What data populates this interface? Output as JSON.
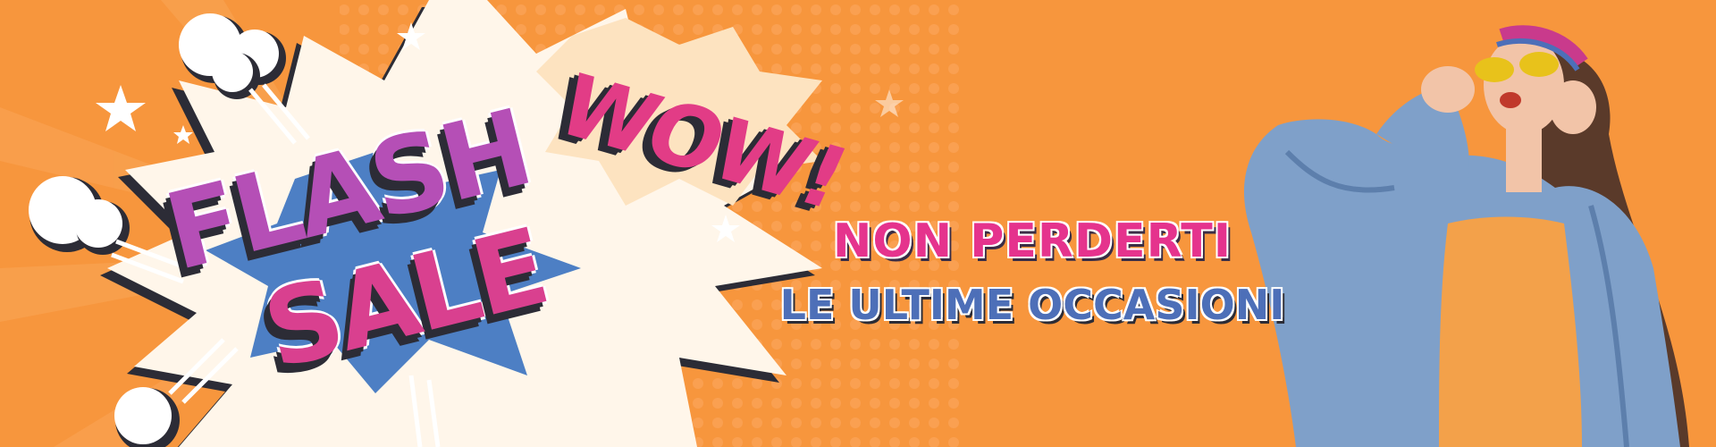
{
  "banner": {
    "flash_word": "FLASH",
    "sale_word": "SALE",
    "wow_word": "WOW!",
    "headline_line1": "NON PERDERTI",
    "headline_line2": "LE ULTIME OCCASIONI"
  },
  "colors": {
    "background": "#f7963d",
    "pink": "#e5338d",
    "purple": "#b54fb6",
    "blue": "#4d6fb8",
    "outline": "#2c2c36",
    "white": "#ffffff"
  },
  "icons": [
    "comic-burst-icon",
    "star-icon",
    "smoke-puff-icon",
    "model-photo"
  ]
}
